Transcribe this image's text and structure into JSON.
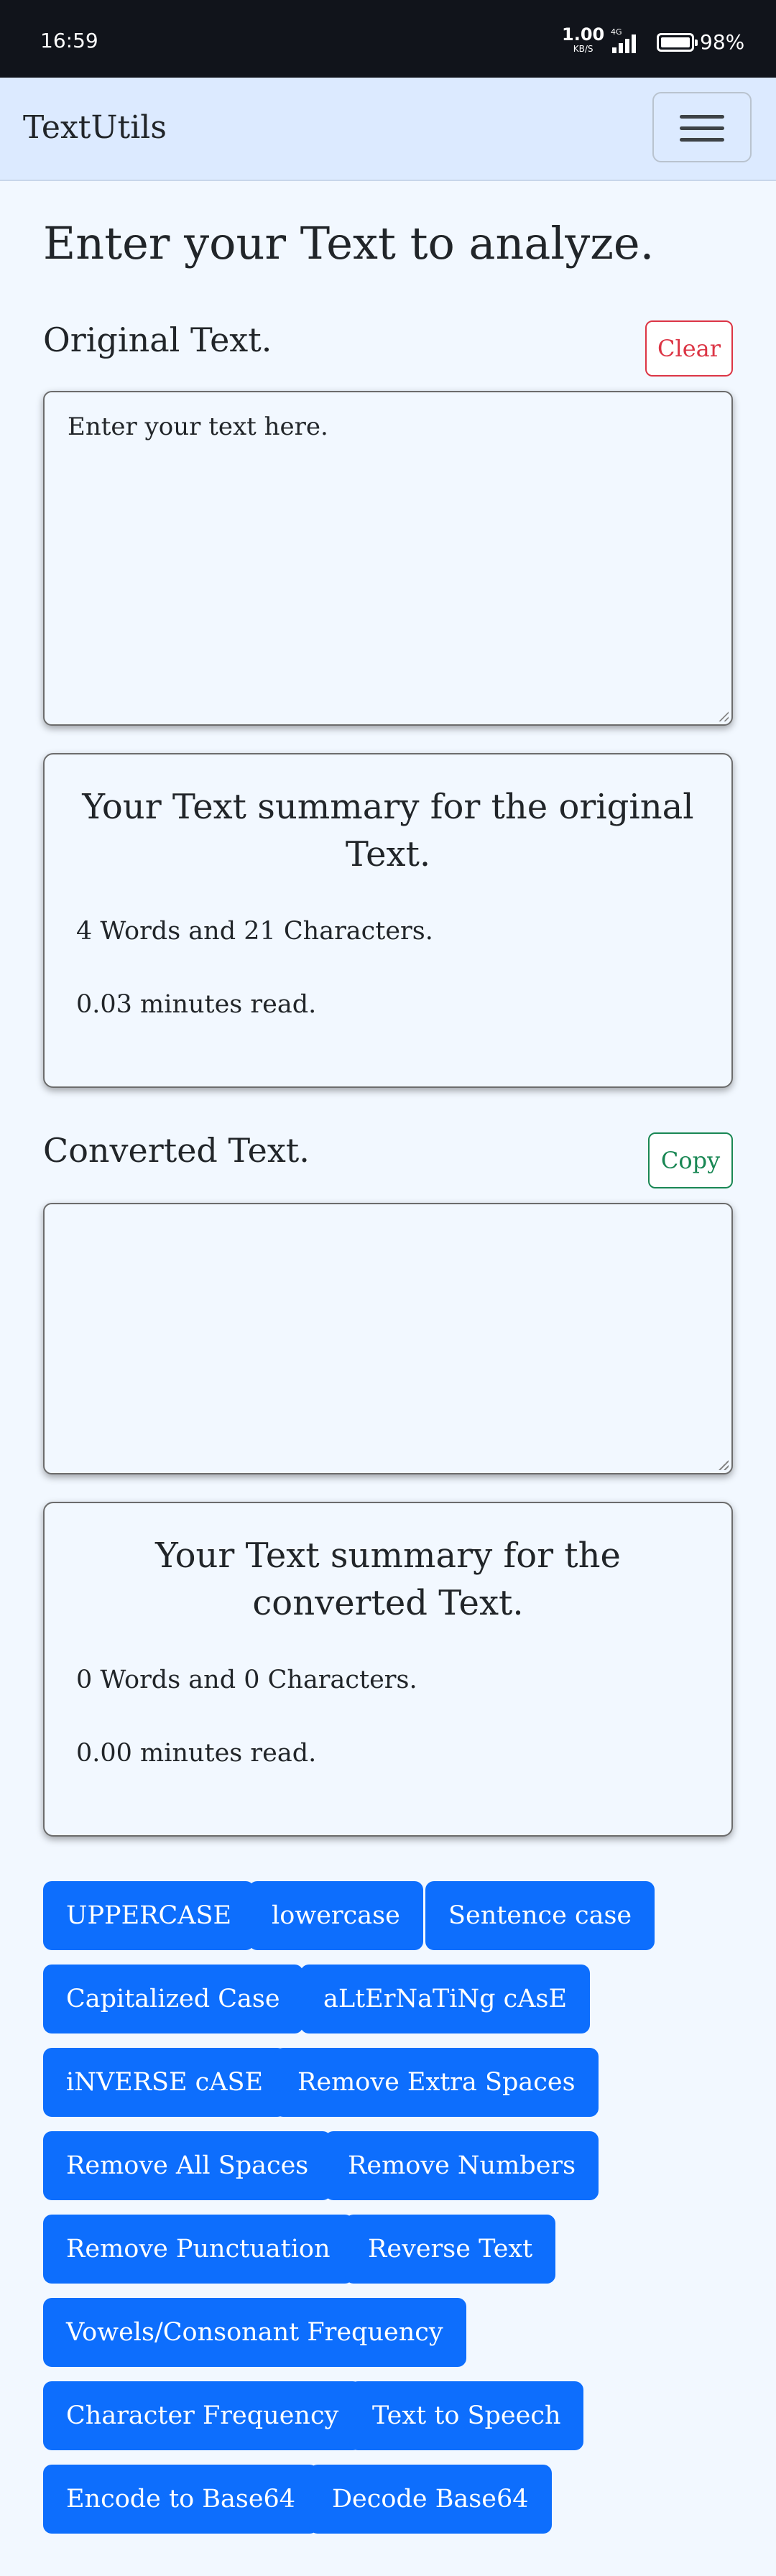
{
  "status_bar": {
    "time": "16:59",
    "net_speed": "1.00",
    "net_unit": "KB/S",
    "signal": "4G",
    "battery": "98%"
  },
  "navbar": {
    "brand": "TextUtils",
    "menu_icon": "hamburger-menu-icon"
  },
  "heading": "Enter your Text to analyze.",
  "original": {
    "label": "Original Text.",
    "clear_label": "Clear",
    "placeholder": "Enter your text here."
  },
  "original_summary": {
    "title": "Your Text summary for the original Text.",
    "counts": "4 Words and 21 Characters.",
    "read_time": "0.03 minutes read."
  },
  "converted": {
    "label": "Converted Text.",
    "copy_label": "Copy",
    "value": ""
  },
  "converted_summary": {
    "title": "Your Text summary for the converted Text.",
    "counts": "0 Words and 0 Characters.",
    "read_time": "0.00 minutes read."
  },
  "actions": [
    "UPPERCASE",
    "lowercase",
    "Sentence case",
    "Capitalized Case",
    "aLtErNaTiNg cAsE",
    "iNVERSE cASE",
    "Remove Extra Spaces",
    "Remove All Spaces",
    "Remove Numbers",
    "Remove Punctuation",
    "Reverse Text",
    "Vowels/Consonant Frequency",
    "Character Frequency",
    "Text to Speech",
    "Encode to Base64",
    "Decode Base64"
  ],
  "colors": {
    "primary": "#0d6efd",
    "danger": "#dc3545",
    "success": "#198754",
    "navbar_bg": "#dceaff",
    "page_bg": "#f2f8ff"
  }
}
